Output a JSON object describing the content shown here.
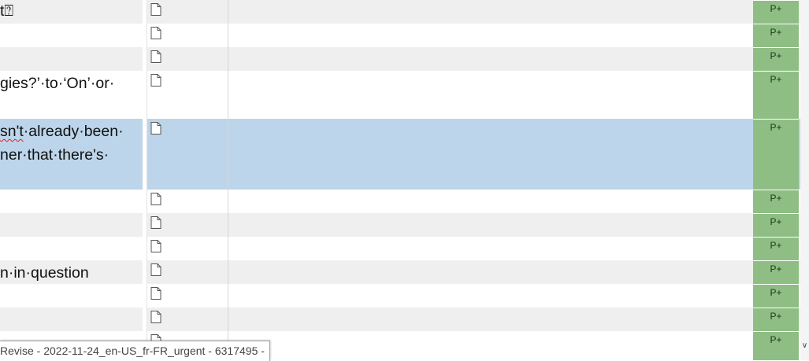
{
  "rows": [
    {
      "lines": [
        "t⍰"
      ],
      "status": "P+",
      "style": "alt"
    },
    {
      "lines": [
        ""
      ],
      "status": "P+",
      "style": "plain"
    },
    {
      "lines": [
        ""
      ],
      "status": "P+",
      "style": "alt"
    },
    {
      "lines": [
        "gies?’·to·‘On’·or·"
      ],
      "status": "P+",
      "style": "plain"
    },
    {
      "lines": [
        "sn't·already·been·",
        "ner·that·there's·"
      ],
      "status": "P+",
      "style": "sel"
    },
    {
      "lines": [
        ""
      ],
      "status": "P+",
      "style": "plain"
    },
    {
      "lines": [
        ""
      ],
      "status": "P+",
      "style": "alt"
    },
    {
      "lines": [
        ""
      ],
      "status": "P+",
      "style": "plain"
    },
    {
      "lines": [
        "n·in·question"
      ],
      "status": "P+",
      "style": "alt"
    },
    {
      "lines": [
        ""
      ],
      "status": "P+",
      "style": "plain"
    },
    {
      "lines": [
        ""
      ],
      "status": "P+",
      "style": "alt"
    },
    {
      "lines": [
        ""
      ],
      "status": "P+",
      "style": "plain"
    }
  ],
  "bottom_tab": {
    "label": "Revise - 2022-11-24_en-US_fr-FR_urgent - 6317495 -"
  },
  "icons": {
    "row_icon": "document-icon",
    "scroll": "chevron-down-icon"
  },
  "colors": {
    "status_bg": "#8fbe85",
    "selected_row": "#bdd5ea",
    "alt_row": "#efefef"
  }
}
